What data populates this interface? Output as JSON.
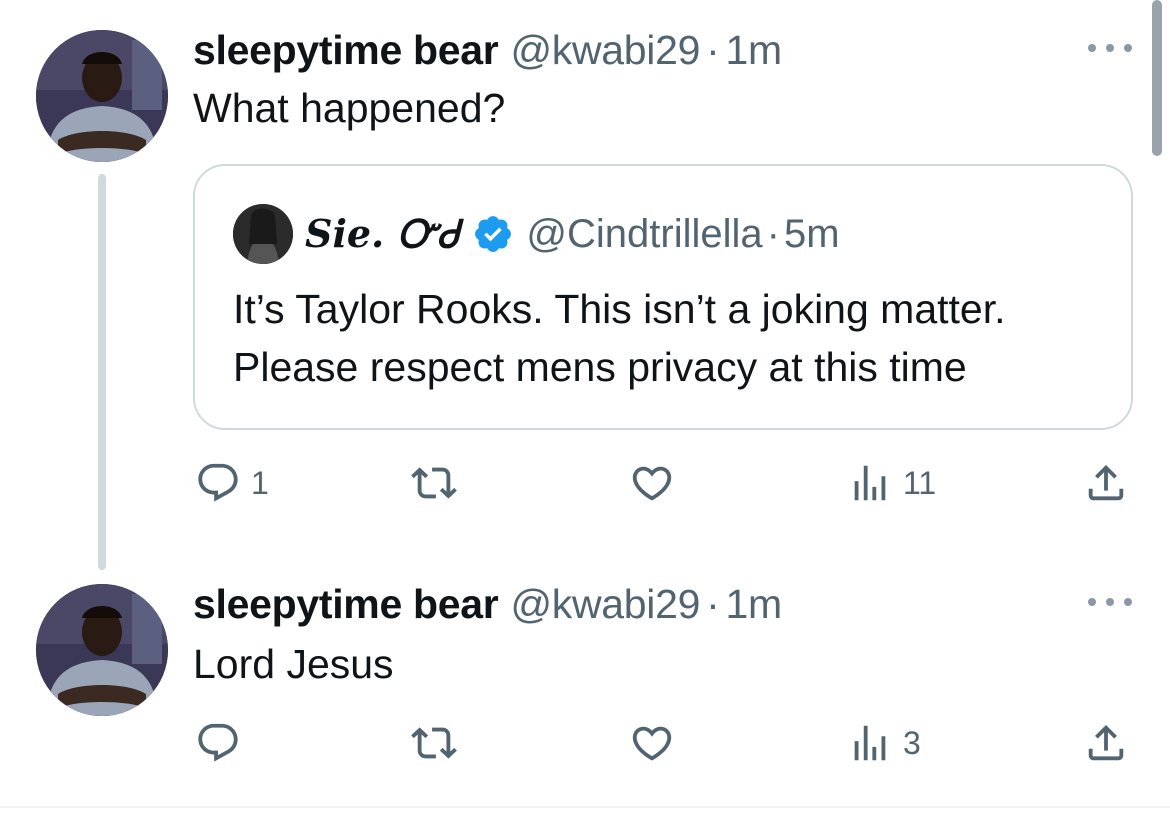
{
  "colors": {
    "text": "#0f1419",
    "secondary": "#536471",
    "border": "#cfd9de",
    "verified": "#1d9bf0"
  },
  "tweets": [
    {
      "name": "sleepytime bear",
      "handle": "@kwabi29",
      "separator": "·",
      "time": "1m",
      "text": "What happened?",
      "quote": {
        "name": "Sie. ᏅᏧ",
        "handle": "@Cindtrillella",
        "separator": "·",
        "time": "5m",
        "text": "It’s Taylor Rooks. This isn’t a joking matter. Please respect mens privacy at this time"
      },
      "stats": {
        "replies": "1",
        "retweets": "",
        "likes": "",
        "views": "11"
      }
    },
    {
      "name": "sleepytime bear",
      "handle": "@kwabi29",
      "separator": "·",
      "time": "1m",
      "text": "Lord Jesus",
      "stats": {
        "replies": "",
        "retweets": "",
        "likes": "",
        "views": "3"
      }
    }
  ],
  "icons": [
    "more-icon",
    "reply-icon",
    "retweet-icon",
    "like-icon",
    "views-icon",
    "share-icon",
    "verified-badge-icon"
  ]
}
